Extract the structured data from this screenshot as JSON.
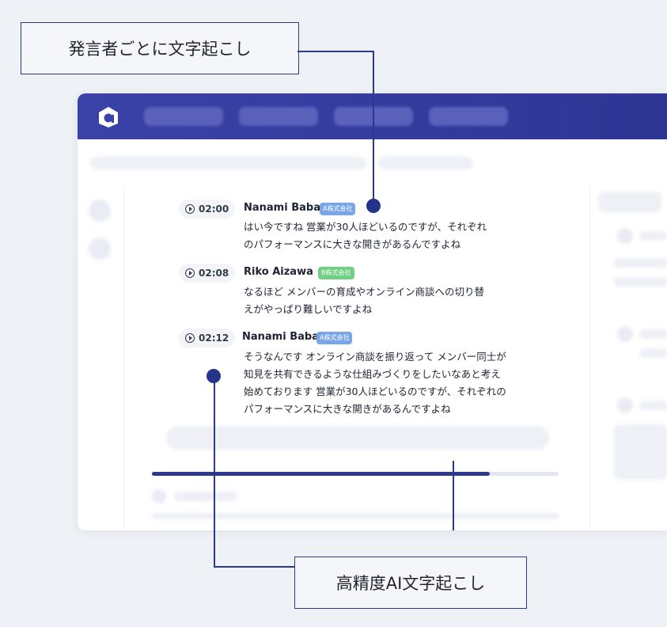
{
  "callouts": {
    "top": "発言者ごとに文字起こし",
    "bottom": "高精度AI文字起こし"
  },
  "transcript": [
    {
      "time": "02:00",
      "speaker": "Nanami Baba",
      "company": "A株式会社",
      "lines": [
        "はい今ですね 営業が30人ほどいるのですが、それぞれ",
        "のパフォーマンスに大きな開きがあるんですよね"
      ]
    },
    {
      "time": "02:08",
      "speaker": "Riko Aizawa",
      "company": "B株式会社",
      "lines": [
        "なるほど メンバーの育成やオンライン商談への切り替",
        "えがやっぱり難しいですよね"
      ]
    },
    {
      "time": "02:12",
      "speaker": "Nanami Baba",
      "company": "A株式会社",
      "lines": [
        "そうなんです オンライン商談を振り返って メンバー同士が",
        "知見を共有できるような仕組みづくりをしたいなあと考え",
        "始めております 営業が30人ほどいるのですが、それぞれの",
        "パフォーマンスに大きな開きがあるんですよね"
      ]
    }
  ],
  "player": {
    "progress": 0.83
  },
  "colors": {
    "appbar": "#3a42a8",
    "accent": "#2d3a8c",
    "badge_a": "#7aa6e8",
    "badge_b": "#6fcf84"
  },
  "icons": {
    "logo": "app-logo-icon",
    "play": "play-circle-icon"
  }
}
